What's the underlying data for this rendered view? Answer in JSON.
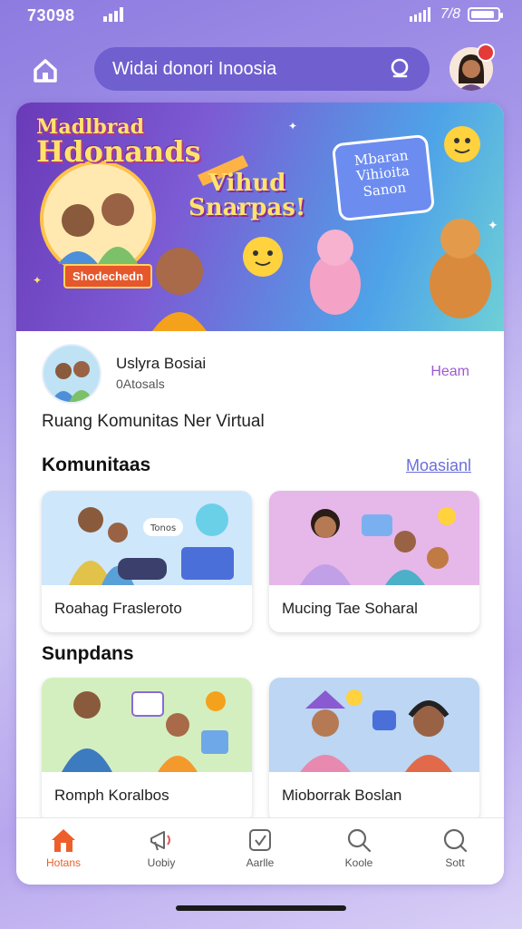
{
  "status_bar": {
    "time": "73098",
    "network": "7/8",
    "battery_level": 0.9
  },
  "search": {
    "text": "Widai donori Inoosia"
  },
  "banner": {
    "title_line1": "Madlbrad",
    "title_line2": "Hdonands",
    "subtitle_line1": "Vihud",
    "subtitle_line2": "Snarpas!",
    "tag": "Shodechedn",
    "bubble_line1": "Mbaran",
    "bubble_line2": "Vihioita",
    "bubble_line3": "Sanon"
  },
  "profile": {
    "name": "Uslyra Bosiai",
    "subtitle": "0Atosals",
    "link": "Heam"
  },
  "tagline": "Ruang Komunitas Ner Virtual",
  "komunitas": {
    "title": "Komunitaas",
    "link": "Moasianl",
    "tiles": [
      {
        "label": "Roahag Frasleroto",
        "badge": "Tonos"
      },
      {
        "label": "Mucing Tae Soharal"
      }
    ]
  },
  "sunpdans": {
    "title": "Sunpdans",
    "tiles": [
      {
        "label": "Romph Koralbos"
      },
      {
        "label": "Mioborrak Boslan"
      }
    ]
  },
  "nav": [
    {
      "label": "Hotans",
      "icon": "home-icon",
      "active": true
    },
    {
      "label": "Uobiy",
      "icon": "megaphone-icon"
    },
    {
      "label": "Aarlle",
      "icon": "edit-box-icon"
    },
    {
      "label": "Koole",
      "icon": "search-icon"
    },
    {
      "label": "Sott",
      "icon": "search-alt-icon"
    }
  ],
  "colors": {
    "accent": "#e8602c",
    "search_pill": "#6f5fcf",
    "link_purple": "#a05ad0",
    "link_blue": "#6b6fd8"
  }
}
